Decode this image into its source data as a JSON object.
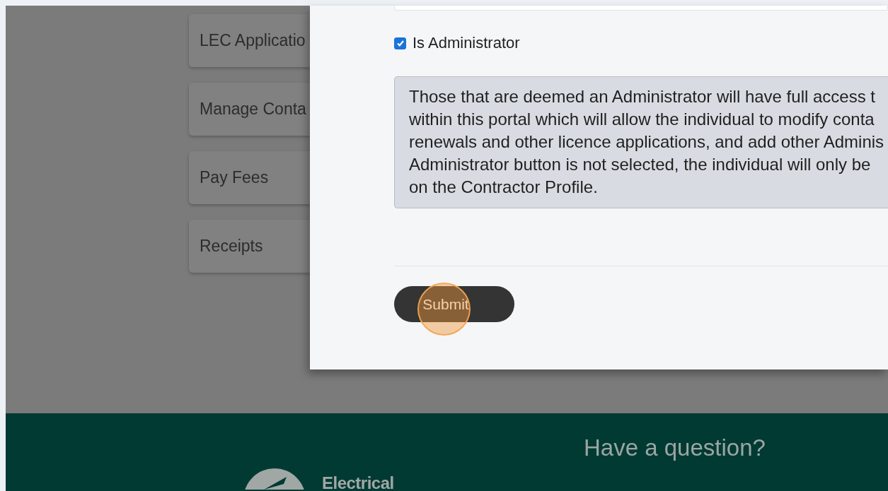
{
  "sidebar": {
    "items": [
      {
        "label": "LEC Applicatio"
      },
      {
        "label": "Manage Conta"
      },
      {
        "label": "Pay Fees"
      },
      {
        "label": "Receipts"
      }
    ]
  },
  "modal": {
    "administrator": {
      "label": "Is Administrator",
      "checked": true
    },
    "notice_lines": [
      "Those that are deemed an Administrator will have full access t",
      "within this portal which will allow the individual to modify conta",
      "renewals and other licence applications, and add other Adminis",
      "Administrator button is not selected, the individual will only be",
      "on the Contractor Profile."
    ],
    "submit": "Submit"
  },
  "footer": {
    "heading": "Have a question?",
    "logo_text": "Electrical"
  }
}
